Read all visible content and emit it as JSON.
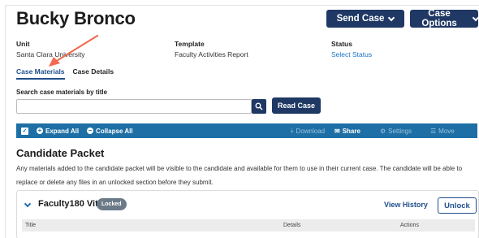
{
  "header": {
    "title": "Bucky Bronco",
    "send_case_label": "Send Case",
    "case_options_label": "Case Options"
  },
  "meta": {
    "unit_label": "Unit",
    "unit_value": "Santa Clara University",
    "template_label": "Template",
    "template_value": "Faculty Activities Report",
    "status_label": "Status",
    "status_value": "Select Status"
  },
  "tabs": [
    {
      "label": "Case Materials",
      "active": true
    },
    {
      "label": "Case Details",
      "active": false
    }
  ],
  "search": {
    "label": "Search case materials by title",
    "value": "",
    "placeholder": "",
    "read_case_label": "Read Case"
  },
  "toolbar": {
    "expand_all": "Expand All",
    "collapse_all": "Collapse All",
    "download": "Download",
    "share": "Share",
    "settings": "Settings",
    "move": "Move"
  },
  "section": {
    "title": "Candidate Packet",
    "description": "Any materials added to the candidate packet will be visible to the candidate and available for them to use in their current case. The candidate will be able to replace or delete any files in an unlocked section before they submit."
  },
  "card": {
    "title": "Faculty180 Vita",
    "badge": "Locked",
    "view_history": "View History",
    "unlock": "Unlock",
    "columns": [
      "Title",
      "Details",
      "Actions"
    ]
  },
  "colors": {
    "navy": "#1f3864",
    "toolbar_blue": "#1d6fa5",
    "link_blue": "#1a73c8",
    "annotation_arrow": "#f26b50"
  }
}
